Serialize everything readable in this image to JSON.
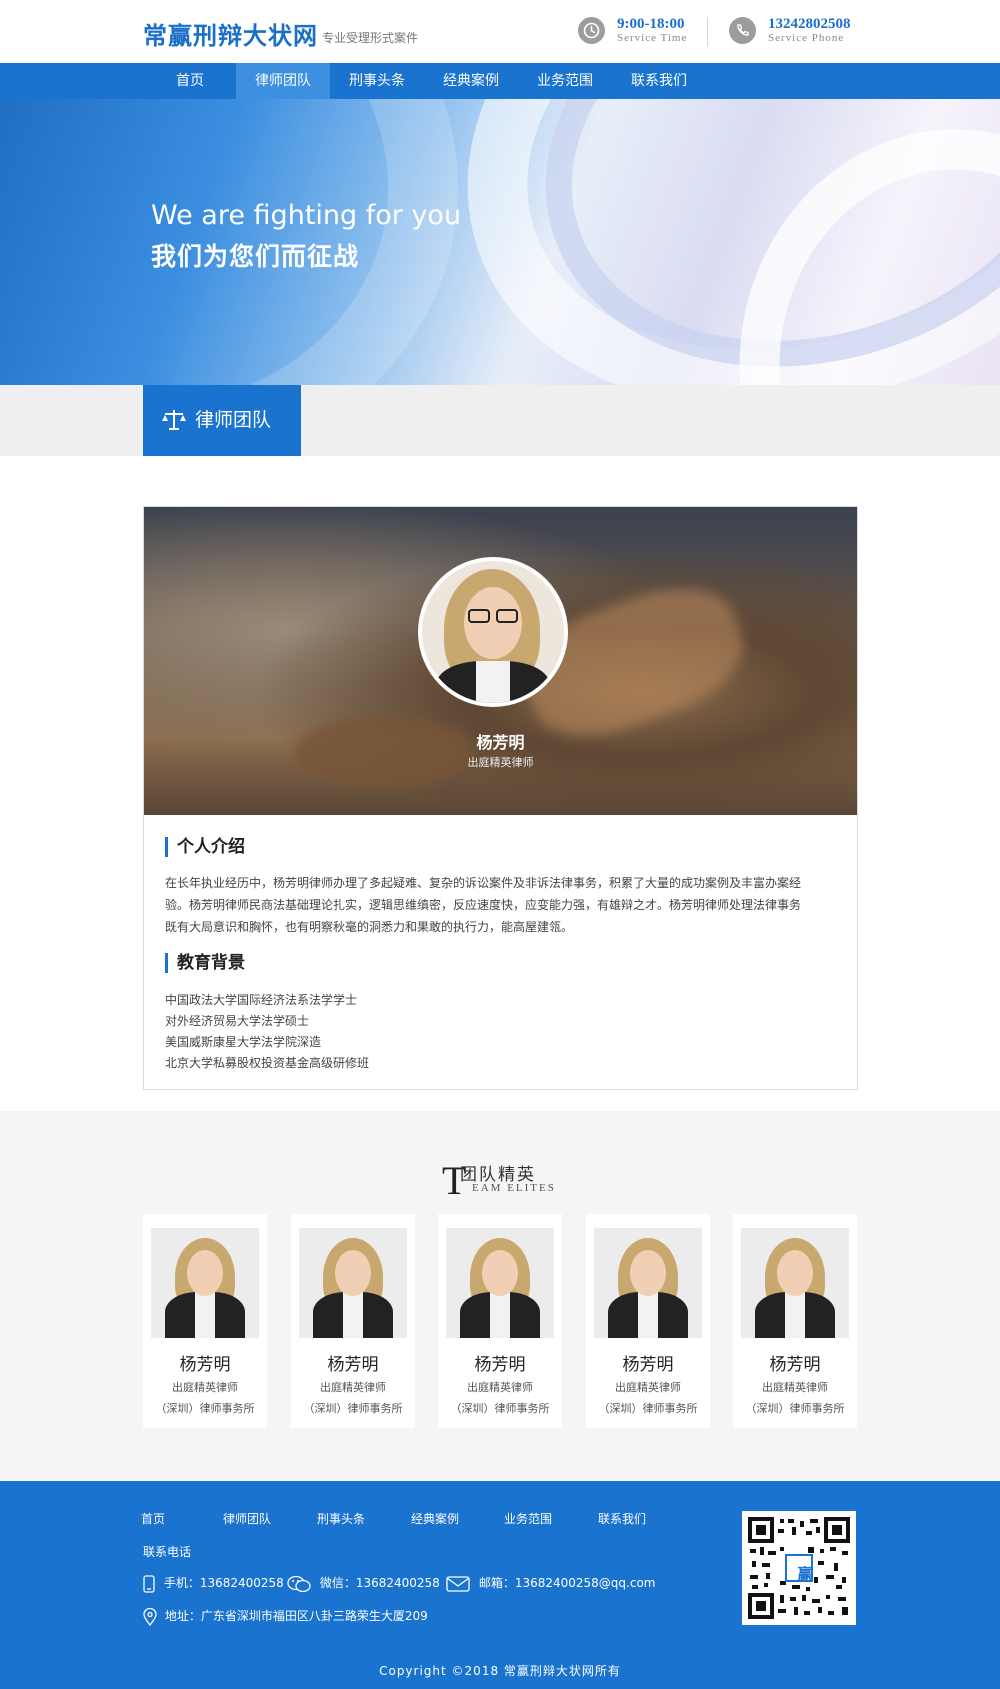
{
  "header": {
    "logo": "常赢刑辩大状网",
    "slogan": "专业受理形式案件",
    "service_time": "9:00-18:00",
    "service_time_label": "Service Time",
    "service_phone": "13242802508",
    "service_phone_label": "Service Phone"
  },
  "nav": {
    "items": [
      {
        "label": "首页"
      },
      {
        "label": "律师团队"
      },
      {
        "label": "刑事头条"
      },
      {
        "label": "经典案例"
      },
      {
        "label": "业务范围"
      },
      {
        "label": "联系我们"
      }
    ],
    "active": "律师团队"
  },
  "banner": {
    "en": "We are fighting for you",
    "cn": "我们为您们而征战"
  },
  "section": {
    "title": "律师团队"
  },
  "profile": {
    "name": "杨芳明",
    "title": "出庭精英律师",
    "intro_heading": "个人介绍",
    "intro_lines": [
      "在长年执业经历中，杨芳明律师办理了多起疑难、复杂的诉讼案件及非诉法律事务，积累了大量的成功案例及丰富办案经",
      "验。杨芳明律师民商法基础理论扎实，逻辑思维缜密，反应速度快，应变能力强，有雄辩之才。杨芳明律师处理法律事务",
      "既有大局意识和胸怀，也有明察秋毫的洞悉力和果敢的执行力，能高屋建瓴。"
    ],
    "edu_heading": "教育背景",
    "education": [
      "中国政法大学国际经济法系法学学士",
      "对外经济贸易大学法学硕士",
      "美国威斯康星大学法学院深造",
      "北京大学私募股权投资基金高级研修班"
    ]
  },
  "team": {
    "title_letter": "T",
    "title_cn": "团队精英",
    "title_en": "EAM  ELITES",
    "members": [
      {
        "name": "杨芳明",
        "title": "出庭精英律师",
        "firm": "（深圳）律师事务所"
      },
      {
        "name": "杨芳明",
        "title": "出庭精英律师",
        "firm": "（深圳）律师事务所"
      },
      {
        "name": "杨芳明",
        "title": "出庭精英律师",
        "firm": "（深圳）律师事务所"
      },
      {
        "name": "杨芳明",
        "title": "出庭精英律师",
        "firm": "（深圳）律师事务所"
      },
      {
        "name": "杨芳明",
        "title": "出庭精英律师",
        "firm": "（深圳）律师事务所"
      }
    ]
  },
  "footer": {
    "links": [
      "首页",
      "律师团队",
      "刑事头条",
      "经典案例",
      "业务范围",
      "联系我们"
    ],
    "contact_label": "联系电话",
    "mobile": "手机：13682400258",
    "wechat": "微信：13682400258",
    "email": "邮箱：13682400258@qq.com",
    "address": "地址：广东省深圳市福田区八卦三路荣生大厦209",
    "qr_center": "赢",
    "copyright": "Copyright ©2018   常赢刑辩大状网所有"
  },
  "colors": {
    "brand_blue": "#1a73cf",
    "nav_active": "#3d8fe1",
    "band_gray": "#efefef",
    "team_bg": "#f5f5f5"
  }
}
